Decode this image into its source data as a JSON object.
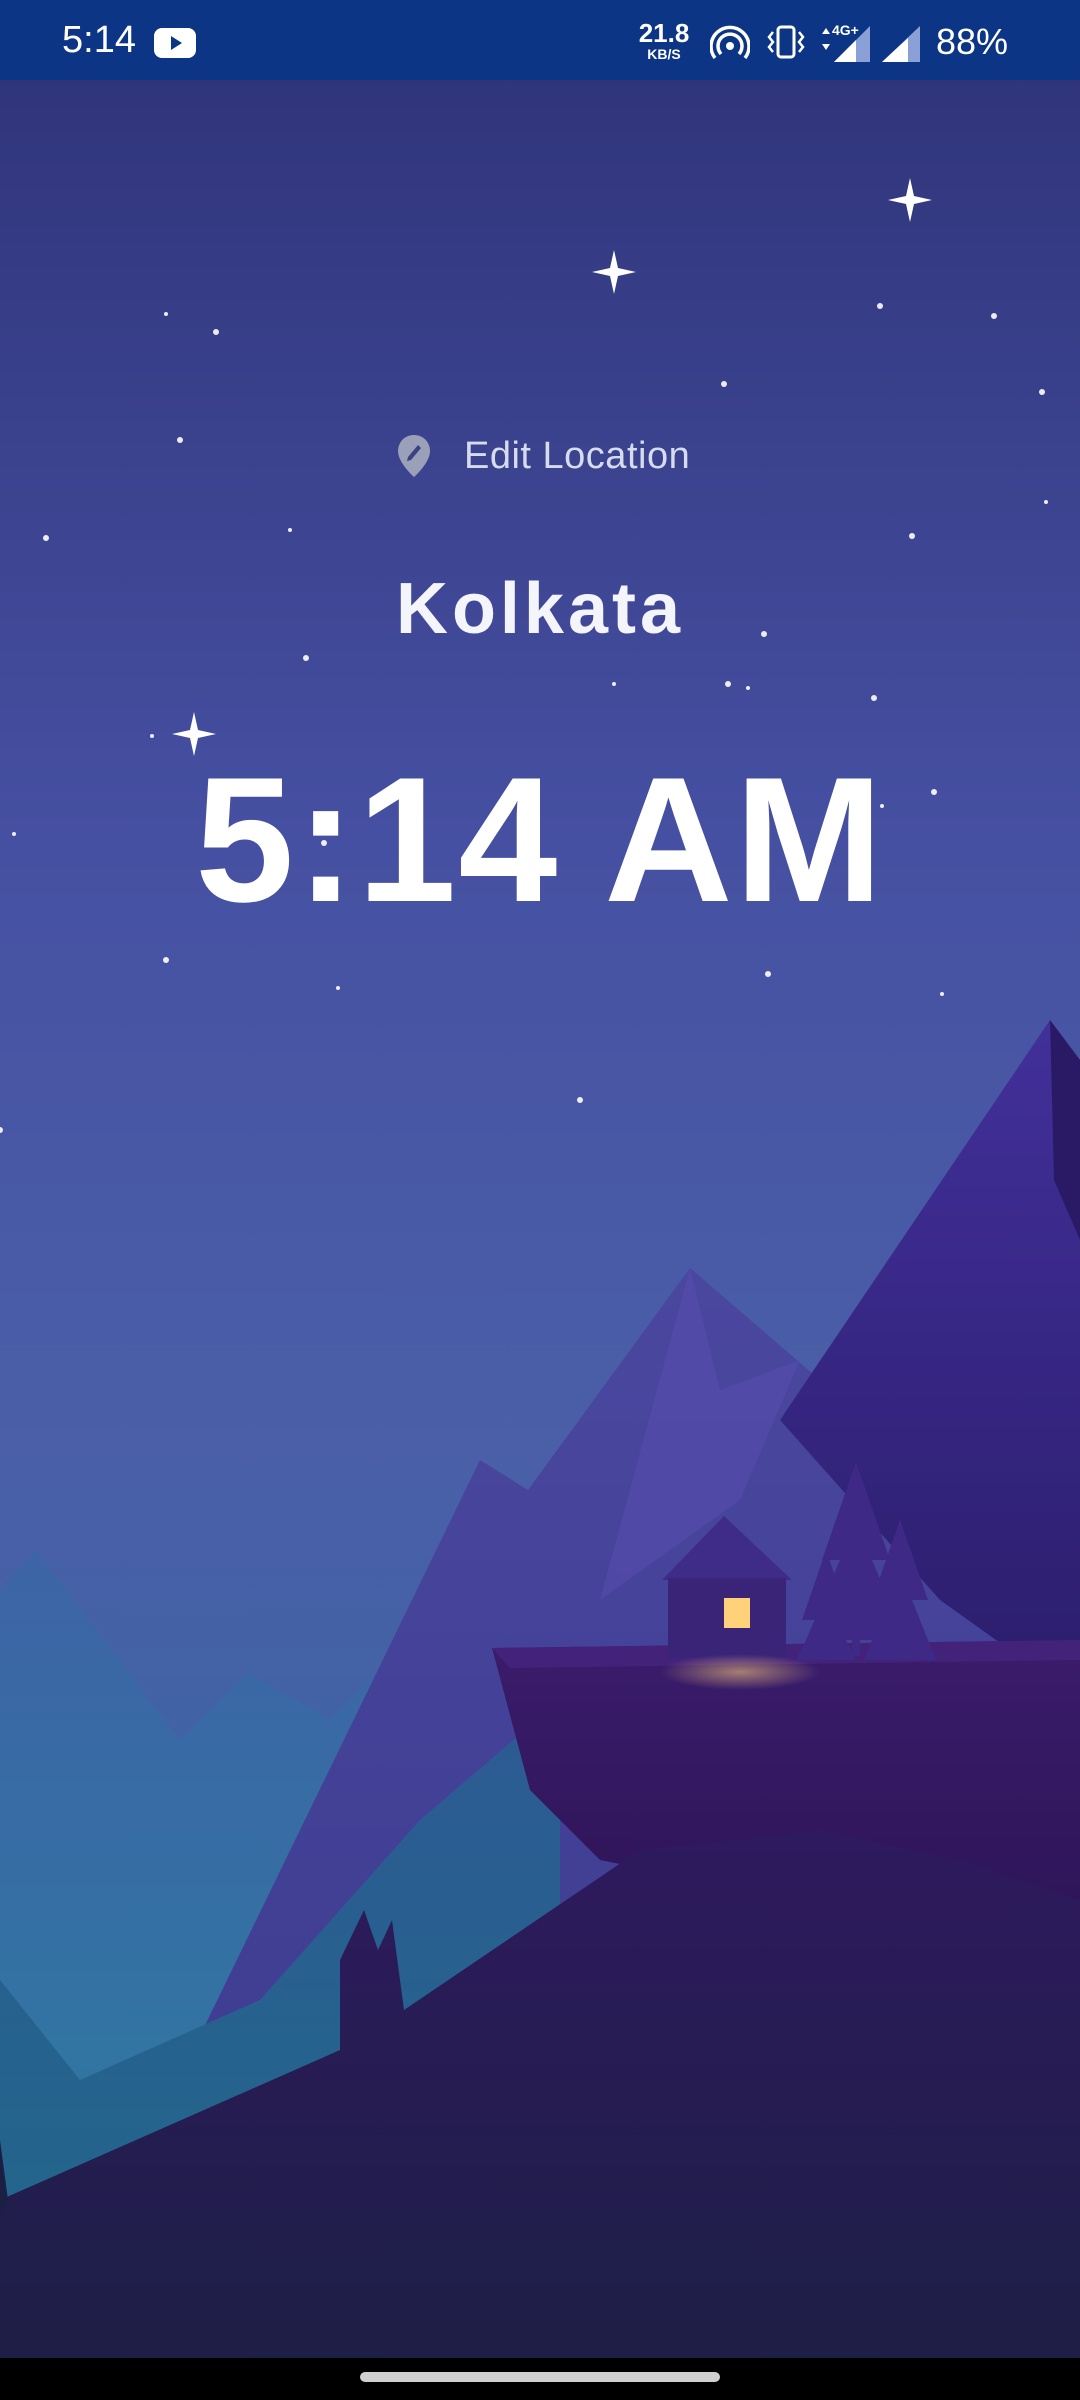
{
  "status_bar": {
    "time": "5:14",
    "net_speed_value": "21.8",
    "net_speed_unit": "KB/S",
    "network_type": "4G+",
    "battery": "88%",
    "icons": [
      "youtube-icon",
      "hotspot-icon",
      "vibrate-icon",
      "signal-icon",
      "signal-icon"
    ]
  },
  "location": {
    "edit_label": "Edit Location",
    "city": "Kolkata"
  },
  "clock": {
    "time": "5:14 AM"
  },
  "colors": {
    "status_bar": "#0d3585",
    "sky_top": "#2f3478",
    "sky_mid": "#4a55a6",
    "mountain_far": "#3c5fa0",
    "mountain_mid": "#4a3c98",
    "mountain_dark": "#2c1650",
    "window_light": "#ffd27a",
    "text": "#ffffff"
  }
}
